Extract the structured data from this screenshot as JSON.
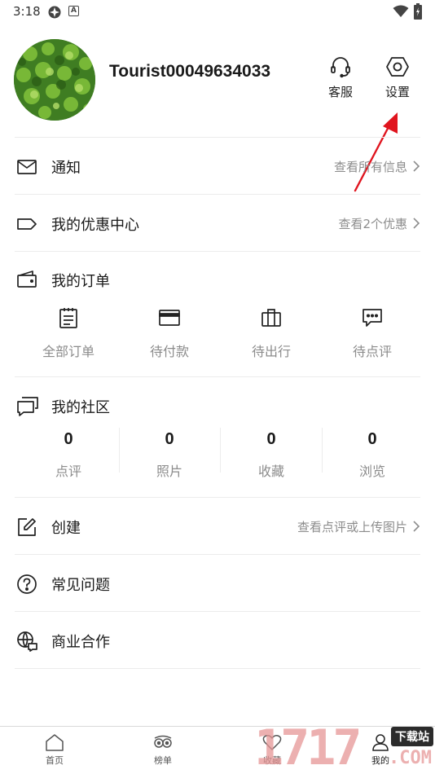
{
  "status": {
    "time": "3:18"
  },
  "profile": {
    "username": "Tourist00049634033"
  },
  "header": {
    "support_label": "客服",
    "settings_label": "设置"
  },
  "menu": {
    "notifications": {
      "label": "通知",
      "hint": "查看所有信息"
    },
    "coupons": {
      "label": "我的优惠中心",
      "hint": "查看2个优惠"
    },
    "create": {
      "label": "创建",
      "hint": "查看点评或上传图片"
    },
    "faq": {
      "label": "常见问题"
    },
    "business": {
      "label": "商业合作"
    }
  },
  "orders": {
    "title": "我的订单",
    "items": [
      {
        "label": "全部订单",
        "icon": "clipboard-icon"
      },
      {
        "label": "待付款",
        "icon": "credit-card-icon"
      },
      {
        "label": "待出行",
        "icon": "suitcase-icon"
      },
      {
        "label": "待点评",
        "icon": "comment-icon"
      }
    ]
  },
  "community": {
    "title": "我的社区",
    "stats": [
      {
        "value": "0",
        "label": "点评"
      },
      {
        "value": "0",
        "label": "照片"
      },
      {
        "value": "0",
        "label": "收藏"
      },
      {
        "value": "0",
        "label": "浏览"
      }
    ]
  },
  "bottom_nav": {
    "tabs": [
      {
        "label": "首页",
        "icon": "home-icon"
      },
      {
        "label": "榜单",
        "icon": "owl-icon"
      },
      {
        "label": "收藏",
        "icon": "heart-icon"
      },
      {
        "label": "我的",
        "icon": "person-icon"
      }
    ]
  },
  "watermark": {
    "digits": "1717",
    "tag": "下载站",
    "suffix": ".COM"
  },
  "colors": {
    "accent_arrow": "#e0141e",
    "hint_text": "#8c8c8c",
    "divider": "#ececec"
  }
}
